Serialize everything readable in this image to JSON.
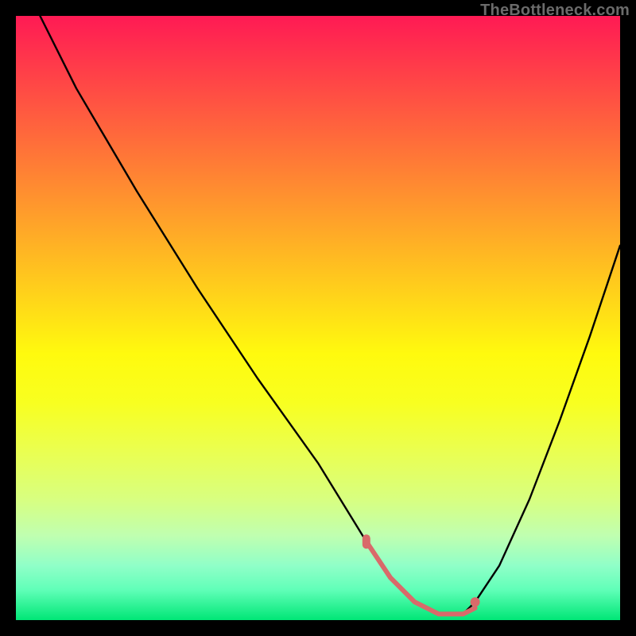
{
  "watermark": "TheBottleneck.com",
  "chart_data": {
    "type": "line",
    "title": "",
    "xlabel": "",
    "ylabel": "",
    "xlim": [
      0,
      100
    ],
    "ylim": [
      0,
      100
    ],
    "grid": false,
    "series": [
      {
        "name": "bottleneck-curve",
        "x": [
          4,
          10,
          20,
          30,
          40,
          50,
          58,
          62,
          66,
          70,
          74,
          76,
          80,
          85,
          90,
          95,
          100
        ],
        "y": [
          100,
          88,
          71,
          55,
          40,
          26,
          13,
          7,
          3,
          1,
          1,
          3,
          9,
          20,
          33,
          47,
          62
        ]
      }
    ],
    "markers": [
      {
        "name": "range-start",
        "x": 58,
        "y": 13,
        "shape": "pill",
        "color": "#d96a6a"
      },
      {
        "name": "range-end",
        "x": 76,
        "y": 3,
        "shape": "dot",
        "color": "#d96a6a"
      }
    ],
    "highlight_segment": {
      "name": "optimal-range",
      "x": [
        58,
        62,
        66,
        70,
        74,
        76
      ],
      "y": [
        13,
        7,
        3,
        1,
        1,
        2
      ],
      "color": "#d96a6a",
      "width": 6
    },
    "background_gradient": {
      "top": "#ff1a54",
      "mid": "#ffe600",
      "bottom": "#00e676"
    }
  }
}
